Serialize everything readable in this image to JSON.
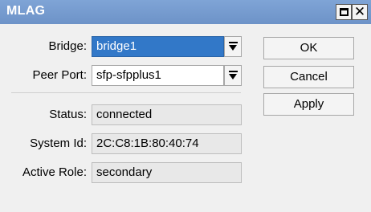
{
  "window": {
    "title": "MLAG"
  },
  "form": {
    "bridge": {
      "label": "Bridge:",
      "value": "bridge1"
    },
    "peer_port": {
      "label": "Peer Port:",
      "value": "sfp-sfpplus1"
    },
    "status": {
      "label": "Status:",
      "value": "connected"
    },
    "system_id": {
      "label": "System Id:",
      "value": "2C:C8:1B:80:40:74"
    },
    "active_role": {
      "label": "Active Role:",
      "value": "secondary"
    }
  },
  "buttons": {
    "ok": "OK",
    "cancel": "Cancel",
    "apply": "Apply"
  },
  "icons": {
    "restore": "restore-icon",
    "close": "close-icon",
    "dropdown": "dropdown-arrow-icon"
  },
  "colors": {
    "titlebar": "#6d93c8",
    "selection": "#3278c8"
  }
}
